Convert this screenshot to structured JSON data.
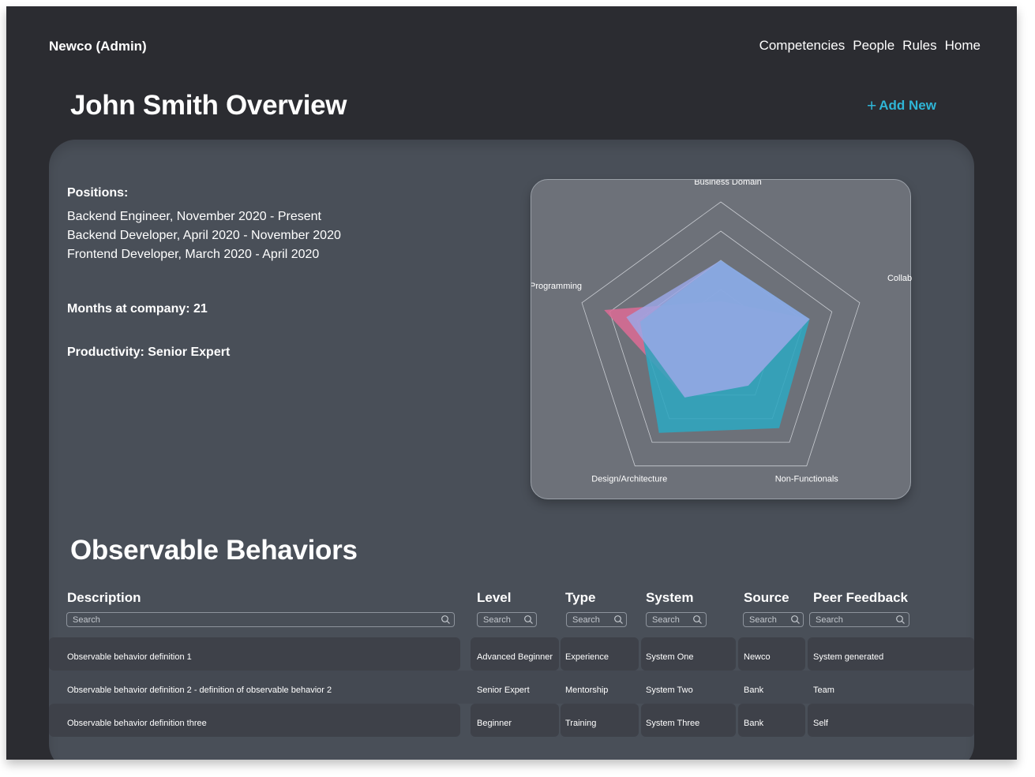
{
  "header": {
    "brand": "Newco (Admin)",
    "nav": [
      "Competencies",
      "People",
      "Rules",
      "Home"
    ]
  },
  "page": {
    "title": "John Smith Overview",
    "add_new": "Add New"
  },
  "profile": {
    "positions_label": "Positions:",
    "positions": [
      "Backend Engineer, November 2020 - Present",
      "Backend Developer, April 2020 - November 2020",
      "Frontend Developer, March 2020 - April 2020"
    ],
    "months": "Months at company: 21",
    "productivity": "Productivity: Senior Expert"
  },
  "chart_data": {
    "type": "radar",
    "axes": [
      "Business Domain",
      "Collaboration",
      "Non-Functionals",
      "Design/Architecture",
      "Programming"
    ],
    "rmax": 5,
    "rings": 5,
    "series": [
      {
        "color": "#d96b94",
        "values": [
          1.6,
          3.2,
          1.6,
          2.1,
          4.2
        ]
      },
      {
        "color": "#2fa6bf",
        "values": [
          3.0,
          3.2,
          3.4,
          3.6,
          2.9
        ]
      },
      {
        "color": "#9ba8e8",
        "values": [
          3.0,
          3.2,
          1.6,
          2.1,
          3.4
        ]
      }
    ]
  },
  "behaviors": {
    "title": "Observable Behaviors",
    "columns": [
      "Description",
      "Level",
      "Type",
      "System",
      "Source",
      "Peer Feedback"
    ],
    "search_placeholder": "Search",
    "rows": [
      [
        "Observable behavior definition 1",
        "Advanced Beginner",
        "Experience",
        "System One",
        "Newco",
        "System generated"
      ],
      [
        "Observable behavior definition 2 - definition of observable behavior 2",
        "Senior Expert",
        "Mentorship",
        "System Two",
        "Bank",
        "Team"
      ],
      [
        "Observable behavior definition three",
        "Beginner",
        "Training",
        "System Three",
        "Bank",
        "Self"
      ]
    ]
  },
  "colors": {
    "accent": "#2fb5d6",
    "background": "#2b2c31",
    "panel": "#494f58",
    "chart_card": "#6d7179"
  }
}
